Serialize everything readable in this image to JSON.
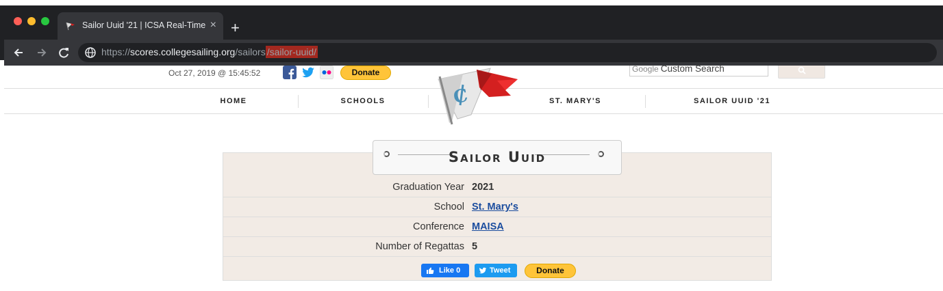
{
  "browser": {
    "tab_title": "Sailor Uuid '21 | ICSA Real-Time",
    "tab_close": "×",
    "new_tab": "+",
    "url_scheme": "https://",
    "url_host": "scores.collegesailing.org",
    "url_path": "/sailors",
    "url_highlight": "/sailor-uuid/",
    "icons": [
      "back-arrow-icon",
      "forward-arrow-icon",
      "reload-icon",
      "globe-icon"
    ]
  },
  "header": {
    "timestamp": "Oct 27, 2019 @ 15:45:52",
    "social_icons": [
      "facebook-icon",
      "twitter-icon",
      "flickr-icon"
    ],
    "donate_label": "Donate",
    "search_brand": "Google",
    "search_placeholder": "Custom Search"
  },
  "nav": {
    "items": [
      "HOME",
      "SCHOOLS",
      "St. Mary's",
      "Sailor Uuid '21"
    ]
  },
  "main": {
    "title": "Sailor Uuid",
    "rows": [
      {
        "label": "Graduation Year",
        "value": "2021"
      },
      {
        "label": "School",
        "value": "St. Mary's"
      },
      {
        "label": "Conference",
        "value": "MAISA"
      },
      {
        "label": "Number of Regattas",
        "value": "5"
      }
    ],
    "like_label": "Like 0",
    "tweet_label": "Tweet",
    "donate_label": "Donate"
  },
  "colors": {
    "accent_red": "#d42020",
    "link_blue": "#1a4c9e",
    "panel_bg": "#f2ebe5",
    "donate_yellow": "#ffc439"
  }
}
